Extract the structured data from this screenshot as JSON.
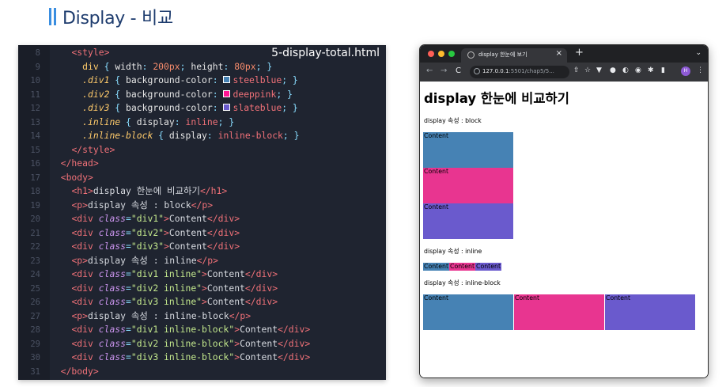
{
  "slide": {
    "title": "Display - 비교"
  },
  "editor": {
    "filename": "5-display-total.html",
    "colors": {
      "steelblue": "#4682b4",
      "deeppink": "#ff1493",
      "slateblue": "#6a5acd"
    },
    "lines": [
      {
        "n": "8",
        "tokens": [
          {
            "t": "<style>",
            "c": "tag"
          }
        ],
        "indent": 4
      },
      {
        "n": "9",
        "tokens": [
          {
            "t": "div",
            "c": "sel"
          },
          {
            "t": " { ",
            "c": "punc"
          },
          {
            "t": "width",
            "c": "prop"
          },
          {
            "t": ": ",
            "c": "punc"
          },
          {
            "t": "200px",
            "c": "num"
          },
          {
            "t": "; ",
            "c": "punc"
          },
          {
            "t": "height",
            "c": "prop"
          },
          {
            "t": ": ",
            "c": "punc"
          },
          {
            "t": "80px",
            "c": "num"
          },
          {
            "t": "; }",
            "c": "punc"
          }
        ],
        "indent": 6
      },
      {
        "n": "10",
        "tokens": [
          {
            "t": ".div1",
            "c": "selit"
          },
          {
            "t": " { ",
            "c": "punc"
          },
          {
            "t": "background-color",
            "c": "prop"
          },
          {
            "t": ": ",
            "c": "punc"
          },
          {
            "t": "",
            "c": "swatch",
            "color": "#4682b4"
          },
          {
            "t": "steelblue",
            "c": "val"
          },
          {
            "t": "; }",
            "c": "punc"
          }
        ],
        "indent": 6
      },
      {
        "n": "11",
        "tokens": [
          {
            "t": ".div2",
            "c": "selit"
          },
          {
            "t": " { ",
            "c": "punc"
          },
          {
            "t": "background-color",
            "c": "prop"
          },
          {
            "t": ": ",
            "c": "punc"
          },
          {
            "t": "",
            "c": "swatch",
            "color": "#ff1493"
          },
          {
            "t": "deeppink",
            "c": "val"
          },
          {
            "t": "; }",
            "c": "punc"
          }
        ],
        "indent": 6
      },
      {
        "n": "12",
        "tokens": [
          {
            "t": ".div3",
            "c": "selit"
          },
          {
            "t": " { ",
            "c": "punc"
          },
          {
            "t": "background-color",
            "c": "prop"
          },
          {
            "t": ": ",
            "c": "punc"
          },
          {
            "t": "",
            "c": "swatch",
            "color": "#6a5acd"
          },
          {
            "t": "slateblue",
            "c": "val"
          },
          {
            "t": "; }",
            "c": "punc"
          }
        ],
        "indent": 6
      },
      {
        "n": "13",
        "tokens": [
          {
            "t": ".inline",
            "c": "selit"
          },
          {
            "t": " { ",
            "c": "punc"
          },
          {
            "t": "display",
            "c": "prop"
          },
          {
            "t": ": ",
            "c": "punc"
          },
          {
            "t": "inline",
            "c": "val"
          },
          {
            "t": "; }",
            "c": "punc"
          }
        ],
        "indent": 6
      },
      {
        "n": "14",
        "tokens": [
          {
            "t": ".inline-block",
            "c": "selit"
          },
          {
            "t": " { ",
            "c": "punc"
          },
          {
            "t": "display",
            "c": "prop"
          },
          {
            "t": ": ",
            "c": "punc"
          },
          {
            "t": "inline-block",
            "c": "val"
          },
          {
            "t": "; }",
            "c": "punc"
          }
        ],
        "indent": 6
      },
      {
        "n": "15",
        "tokens": [
          {
            "t": "</style>",
            "c": "tag"
          }
        ],
        "indent": 4
      },
      {
        "n": "16",
        "tokens": [
          {
            "t": "</head>",
            "c": "tag"
          }
        ],
        "indent": 2
      },
      {
        "n": "17",
        "tokens": [
          {
            "t": "<body>",
            "c": "tag"
          }
        ],
        "indent": 2
      },
      {
        "n": "18",
        "tokens": [
          {
            "t": "<h1>",
            "c": "tag"
          },
          {
            "t": "display 한눈에 비교하기",
            "c": "text"
          },
          {
            "t": "</h1>",
            "c": "tag"
          }
        ],
        "indent": 4
      },
      {
        "n": "19",
        "tokens": [
          {
            "t": "<p>",
            "c": "tag"
          },
          {
            "t": "display 속성 : block",
            "c": "text"
          },
          {
            "t": "</p>",
            "c": "tag"
          }
        ],
        "indent": 4
      },
      {
        "n": "20",
        "tokens": [
          {
            "t": "<div ",
            "c": "tag"
          },
          {
            "t": "class",
            "c": "attr"
          },
          {
            "t": "=",
            "c": "punc"
          },
          {
            "t": "\"div1\"",
            "c": "str"
          },
          {
            "t": ">",
            "c": "tag"
          },
          {
            "t": "Content",
            "c": "text"
          },
          {
            "t": "</div>",
            "c": "tag"
          }
        ],
        "indent": 4
      },
      {
        "n": "21",
        "tokens": [
          {
            "t": "<div ",
            "c": "tag"
          },
          {
            "t": "class",
            "c": "attr"
          },
          {
            "t": "=",
            "c": "punc"
          },
          {
            "t": "\"div2\"",
            "c": "str"
          },
          {
            "t": ">",
            "c": "tag"
          },
          {
            "t": "Content",
            "c": "text"
          },
          {
            "t": "</div>",
            "c": "tag"
          }
        ],
        "indent": 4
      },
      {
        "n": "22",
        "tokens": [
          {
            "t": "<div ",
            "c": "tag"
          },
          {
            "t": "class",
            "c": "attr"
          },
          {
            "t": "=",
            "c": "punc"
          },
          {
            "t": "\"div3\"",
            "c": "str"
          },
          {
            "t": ">",
            "c": "tag"
          },
          {
            "t": "Content",
            "c": "text"
          },
          {
            "t": "</div>",
            "c": "tag"
          }
        ],
        "indent": 4
      },
      {
        "n": "23",
        "tokens": [
          {
            "t": "<p>",
            "c": "tag"
          },
          {
            "t": "display 속성 : inline",
            "c": "text"
          },
          {
            "t": "</p>",
            "c": "tag"
          }
        ],
        "indent": 4
      },
      {
        "n": "24",
        "tokens": [
          {
            "t": "<div ",
            "c": "tag"
          },
          {
            "t": "class",
            "c": "attr"
          },
          {
            "t": "=",
            "c": "punc"
          },
          {
            "t": "\"div1 inline\"",
            "c": "str"
          },
          {
            "t": ">",
            "c": "tag"
          },
          {
            "t": "Content",
            "c": "text"
          },
          {
            "t": "</div>",
            "c": "tag"
          }
        ],
        "indent": 4
      },
      {
        "n": "25",
        "tokens": [
          {
            "t": "<div ",
            "c": "tag"
          },
          {
            "t": "class",
            "c": "attr"
          },
          {
            "t": "=",
            "c": "punc"
          },
          {
            "t": "\"div2 inline\"",
            "c": "str"
          },
          {
            "t": ">",
            "c": "tag"
          },
          {
            "t": "Content",
            "c": "text"
          },
          {
            "t": "</div>",
            "c": "tag"
          }
        ],
        "indent": 4
      },
      {
        "n": "26",
        "tokens": [
          {
            "t": "<div ",
            "c": "tag"
          },
          {
            "t": "class",
            "c": "attr"
          },
          {
            "t": "=",
            "c": "punc"
          },
          {
            "t": "\"div3 inline\"",
            "c": "str"
          },
          {
            "t": ">",
            "c": "tag"
          },
          {
            "t": "Content",
            "c": "text"
          },
          {
            "t": "</div>",
            "c": "tag"
          }
        ],
        "indent": 4
      },
      {
        "n": "27",
        "tokens": [
          {
            "t": "<p>",
            "c": "tag"
          },
          {
            "t": "display 속성 : inline-block",
            "c": "text"
          },
          {
            "t": "</p>",
            "c": "tag"
          }
        ],
        "indent": 4
      },
      {
        "n": "28",
        "tokens": [
          {
            "t": "<div ",
            "c": "tag"
          },
          {
            "t": "class",
            "c": "attr"
          },
          {
            "t": "=",
            "c": "punc"
          },
          {
            "t": "\"div1 inline-block\"",
            "c": "str"
          },
          {
            "t": ">",
            "c": "tag"
          },
          {
            "t": "Content",
            "c": "text"
          },
          {
            "t": "</div>",
            "c": "tag"
          }
        ],
        "indent": 4
      },
      {
        "n": "29",
        "tokens": [
          {
            "t": "<div ",
            "c": "tag"
          },
          {
            "t": "class",
            "c": "attr"
          },
          {
            "t": "=",
            "c": "punc"
          },
          {
            "t": "\"div2 inline-block\"",
            "c": "str"
          },
          {
            "t": ">",
            "c": "tag"
          },
          {
            "t": "Content",
            "c": "text"
          },
          {
            "t": "</div>",
            "c": "tag"
          }
        ],
        "indent": 4
      },
      {
        "n": "30",
        "tokens": [
          {
            "t": "<div ",
            "c": "tag"
          },
          {
            "t": "class",
            "c": "attr"
          },
          {
            "t": "=",
            "c": "punc"
          },
          {
            "t": "\"div3 inline-block\"",
            "c": "str"
          },
          {
            "t": ">",
            "c": "tag"
          },
          {
            "t": "Content",
            "c": "text"
          },
          {
            "t": "</div>",
            "c": "tag"
          }
        ],
        "indent": 4
      },
      {
        "n": "31",
        "tokens": [
          {
            "t": "</body>",
            "c": "tag"
          }
        ],
        "indent": 2
      }
    ]
  },
  "browser": {
    "tab_title": "display 한눈에 보기",
    "tab_close": "×",
    "new_tab": "+",
    "tab_menu": "⌄",
    "nav": {
      "back": "←",
      "forward": "→",
      "reload": "C"
    },
    "url_host": "127.0.0.1",
    "url_path": ":5501/chap5/5...",
    "toolbar_icons": [
      "⇧",
      "☆",
      "▼",
      "●",
      "◐",
      "◉",
      "✱",
      "▮",
      "⋮"
    ],
    "avatar_label": "H",
    "page": {
      "h1": "display 한눈에 비교하기",
      "p_block": "display 속성 : block",
      "p_inline": "display 속성 : inline",
      "p_inline_block": "display 속성 : inline-block",
      "box_label": "Content"
    },
    "colors": {
      "steelblue": "#4682b4",
      "deeppink": "#ff1493",
      "slateblue": "#6a5acd"
    }
  }
}
